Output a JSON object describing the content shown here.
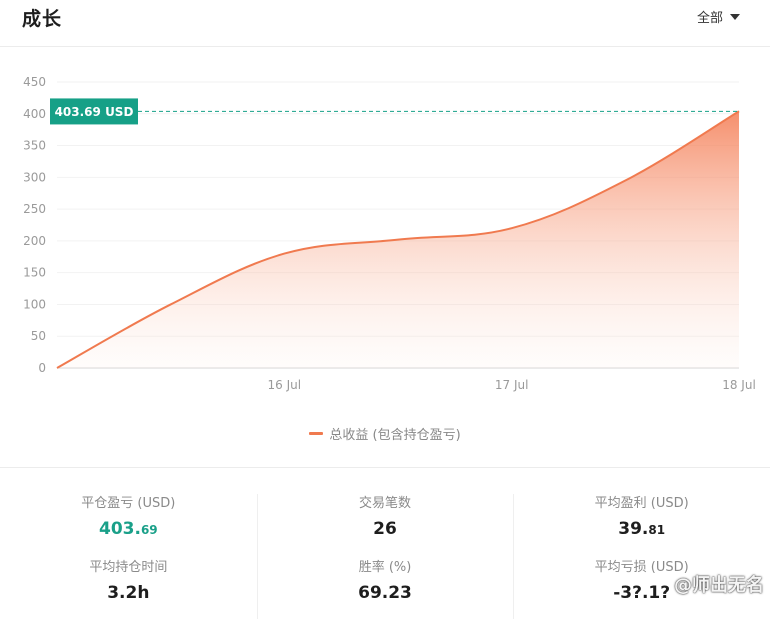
{
  "header": {
    "title": "成长",
    "period_label": "全部"
  },
  "chart_data": {
    "type": "area",
    "title": "",
    "xlabel": "",
    "ylabel": "",
    "ylim": [
      0,
      450
    ],
    "yticks": [
      "450",
      "400",
      "350",
      "300",
      "250",
      "200",
      "150",
      "100",
      "50",
      "0"
    ],
    "xlim": [
      "15 Jul",
      "18 Jul"
    ],
    "xticks": [
      "16 Jul",
      "17 Jul",
      "18 Jul"
    ],
    "grid": true,
    "legend_position": "bottom",
    "series": [
      {
        "name": "总收益 (包含持仓盈亏)",
        "color": "#f07a4f",
        "x": [
          "15 Jul 00:00",
          "15 Jul 12:00",
          "16 Jul 00:00",
          "16 Jul 12:00",
          "17 Jul 00:00",
          "17 Jul 12:00",
          "18 Jul 00:00"
        ],
        "values": [
          0,
          100,
          180,
          202,
          220,
          295,
          404
        ]
      }
    ],
    "annotation": {
      "label": "403.69 USD",
      "value": 403.69,
      "color": "#16a087"
    }
  },
  "stats": {
    "closed_pnl": {
      "label": "平仓盈亏 (USD)",
      "int": "403.",
      "dec": "69"
    },
    "trade_count": {
      "label": "交易笔数",
      "value": "26"
    },
    "avg_profit": {
      "label": "平均盈利 (USD)",
      "int": "39.",
      "dec": "81"
    },
    "avg_hold_time": {
      "label": "平均持仓时间",
      "value": "3.2h"
    },
    "win_rate": {
      "label": "胜率 (%)",
      "value": "69.23"
    },
    "avg_loss": {
      "label": "平均亏损 (USD)",
      "value": "-3?.1?"
    }
  },
  "watermark": "@师出无名"
}
